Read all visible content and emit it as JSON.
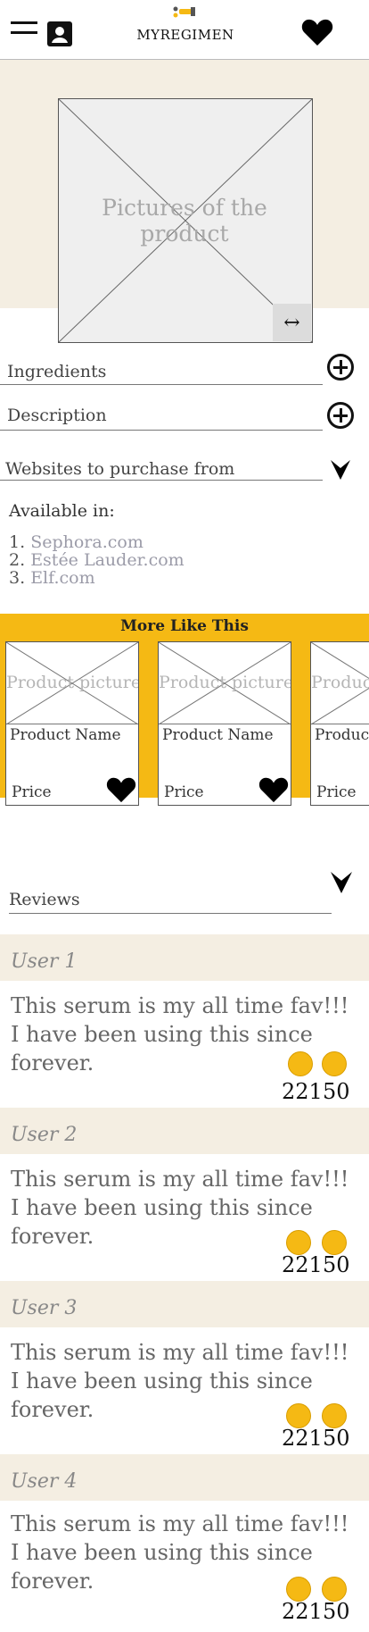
{
  "header": {
    "title": "MYREGIMEN",
    "icons": [
      "hamburger-menu-icon",
      "profile-icon",
      "heart-icon",
      "logo-icon"
    ]
  },
  "product": {
    "image_placeholder": "Pictures of the product",
    "swipe_icon": "↔"
  },
  "sections": {
    "ingredients": "Ingredients",
    "description": "Description",
    "websites": "Websites to purchase from"
  },
  "availability": {
    "title": "Available in:",
    "sites": [
      {
        "num": "1.",
        "name": "Sephora.com"
      },
      {
        "num": "2.",
        "name": "Estée Lauder.com"
      },
      {
        "num": "3.",
        "name": "Elf.com"
      }
    ]
  },
  "more_like_this": {
    "title": "More Like This",
    "cards": [
      {
        "picture": "Product picture",
        "name": "Product Name",
        "price": "Price"
      },
      {
        "picture": "Product picture",
        "name": "Product Name",
        "price": "Price"
      },
      {
        "picture": "Product picture",
        "name": "Product Name",
        "price": "Price"
      }
    ]
  },
  "reviews": {
    "title": "Reviews",
    "items": [
      {
        "user": "User 1",
        "text": "This serum is my all time fav!!! I have been using this since forever.",
        "likes": "221",
        "dislikes": "50"
      },
      {
        "user": "User 2",
        "text": "This serum is my all time fav!!! I have been using this since forever.",
        "likes": "221",
        "dislikes": "50"
      },
      {
        "user": "User 3",
        "text": "This serum is my all time fav!!! I have been using this since forever.",
        "likes": "221",
        "dislikes": "50"
      },
      {
        "user": "User 4",
        "text": "This serum is my all time fav!!! I have been using this since forever.",
        "likes": "221",
        "dislikes": "50"
      }
    ]
  },
  "colors": {
    "accent": "#f5b914",
    "beige": "#f4eee2"
  }
}
